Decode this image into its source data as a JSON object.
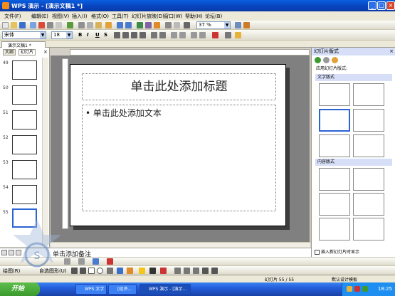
{
  "window": {
    "title": "WPS 演示 - [演示文稿1 *]",
    "min_label": "_",
    "max_label": "□",
    "close_label": "×"
  },
  "menu": {
    "items": [
      "文件(F)",
      "编辑(E)",
      "视图(V)",
      "插入(I)",
      "格式(O)",
      "工具(T)",
      "幻灯片放映(D)",
      "窗口(W)",
      "帮助(H)",
      "论坛(B)"
    ]
  },
  "toolbar": {
    "zoom": "37 %",
    "font_name": "宋体",
    "font_size": "18",
    "bold": "B",
    "italic": "I",
    "underline": "U",
    "shadow": "S"
  },
  "doc_tab": {
    "label": "演示文稿1 *"
  },
  "left_pane": {
    "tabs": [
      "大纲",
      "幻灯片"
    ],
    "slide_numbers": [
      "49",
      "50",
      "51",
      "52",
      "53",
      "54",
      "55"
    ]
  },
  "slide": {
    "title_placeholder": "单击此处添加标题",
    "body_placeholder": "单击此处添加文本",
    "bullet": "•"
  },
  "notes": {
    "placeholder": "单击添加备注"
  },
  "task_pane": {
    "title": "幻灯片版式",
    "section_label": "应用幻灯片版式:",
    "group_text": "文字版式",
    "group_content": "内容版式",
    "checkbox_label": "插入新幻灯片时显示"
  },
  "draw_toolbar": {
    "draw_label": "绘图(R)",
    "autoshape_label": "自选图形(U)"
  },
  "status_bar": {
    "slide_pos": "幻灯片 55 / 55",
    "design": "默认设计模板"
  },
  "taskbar": {
    "start": "开始",
    "tasks": [
      "WPS 文字",
      "[经济...",
      "WPS 演示 - [演示..."
    ],
    "clock": "18:25"
  },
  "colors": {
    "titlebar": "#0846c0",
    "taskbar": "#245edb",
    "start": "#3c9a2e",
    "selection": "#2a63d4"
  }
}
